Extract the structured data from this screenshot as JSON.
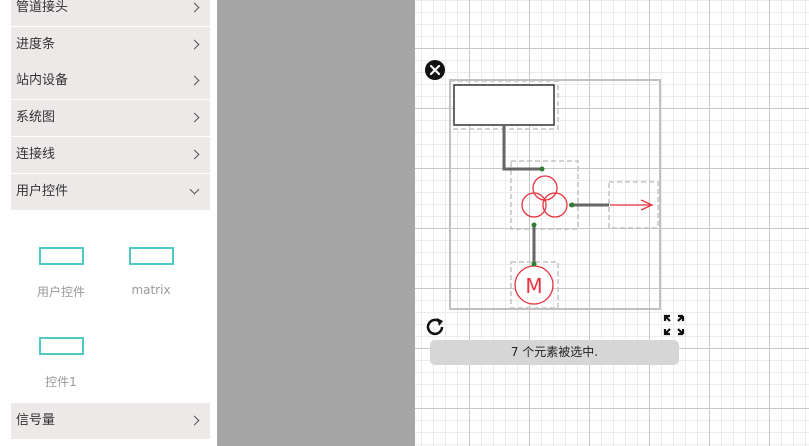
{
  "sidebar": {
    "categories": [
      {
        "label": "管道接头",
        "expanded": false
      },
      {
        "label": "进度条",
        "expanded": false
      },
      {
        "label": "站内设备",
        "expanded": false
      },
      {
        "label": "系统图",
        "expanded": false
      },
      {
        "label": "连接线",
        "expanded": false
      },
      {
        "label": "用户控件",
        "expanded": true
      }
    ],
    "tools": [
      {
        "label": "用户控件"
      },
      {
        "label": "matrix"
      },
      {
        "label": "控件1"
      }
    ],
    "bottom_category": {
      "label": "信号量",
      "expanded": false
    }
  },
  "canvas": {
    "motor_symbol": "M",
    "status_text": "7 个元素被选中.",
    "icons": [
      "close-icon",
      "rotate-icon",
      "fullscreen-icon"
    ],
    "colors": {
      "accent": "#4fc9c2",
      "symbol_red": "#e8343f",
      "wire": "#555555",
      "selection": "#c0c0c0"
    }
  }
}
